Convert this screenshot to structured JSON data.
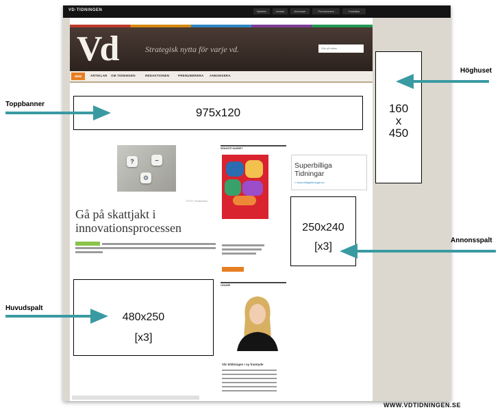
{
  "site": {
    "logo_small": "VD·TIDNINGEN",
    "top_links": [
      "Nyheter",
      "Ledare",
      "Annonser",
      "Prenumerera",
      "Kontakta"
    ],
    "logo": "Vd",
    "tagline": "Strategisk nytta för varje vd.",
    "search_placeholder": "Sök på sidan",
    "nav": [
      "HEM",
      "ARTIKLAR",
      "OM TIDNINGEN",
      "REDAKTIONEN",
      "PRENUMERERA",
      "ANNONSERA"
    ]
  },
  "article": {
    "headline": "Gå på skattjakt i innovationsprocessen",
    "caption": "FOTO: Shutterstock"
  },
  "middle": {
    "section1": "SENASTE NUMRET",
    "magazine_title": "LEDARSKAPETS PUSSELBITAR",
    "section2": "LEDARE",
    "byline": "Vår bildningen i ny framtyde"
  },
  "sidebar_ad": {
    "title": "Superbilliga Tidningar",
    "url": "» www.billigatidningar.se"
  },
  "annotations": {
    "topbanner": {
      "label": "Toppbanner",
      "size": "975x120"
    },
    "skyscraper": {
      "label": "Höghuset",
      "size_w": "160",
      "size_x": "x",
      "size_h": "450"
    },
    "adcol": {
      "label": "Annonsspalt",
      "size": "250x240",
      "count": "[x3]"
    },
    "main": {
      "label": "Huvudspalt",
      "size": "480x250",
      "count": "[x3]"
    }
  },
  "footer_url": "WWW.VDTIDNINGEN.SE",
  "colors": {
    "accent_arrow": "#3a9aa2",
    "header_brown": "#3a2d27",
    "nav_orange": "#e67e22"
  }
}
